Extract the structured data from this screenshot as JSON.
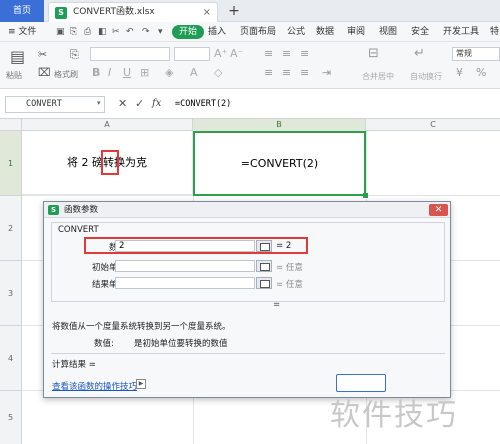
{
  "tabbar": {
    "home": "首页",
    "file_tab": "CONVERT函数.xlsx",
    "xls_badge": "S",
    "close": "×",
    "new_tab": "+"
  },
  "menubar": {
    "file": "≡ 文件",
    "items": [
      "开始",
      "插入",
      "页面布局",
      "公式",
      "数据",
      "审阅",
      "视图",
      "安全",
      "开发工具"
    ],
    "more": "特"
  },
  "ribbon": {
    "paste": "粘贴",
    "format_painter": "格式刷",
    "merge": "合并居中",
    "wrap": "自动换行",
    "style_value": "常规",
    "currency": "¥"
  },
  "formula_bar": {
    "name_box": "CONVERT",
    "fx": "fx",
    "formula": "=CONVERT(2)"
  },
  "columns": [
    "A",
    "B",
    "C"
  ],
  "rows": [
    "1",
    "2",
    "3",
    "4",
    "5"
  ],
  "cells": {
    "a1_pre": "将 ",
    "a1_num": "2",
    "a1_post": " 磅转换为克",
    "b1": "=CONVERT(2)"
  },
  "dialog": {
    "icon": "S",
    "title": "函数参数",
    "close": "✕",
    "function_name": "CONVERT",
    "args": [
      {
        "label": "数值",
        "value": "2",
        "result": "= 2"
      },
      {
        "label": "初始单位",
        "value": "",
        "result": "= 任意"
      },
      {
        "label": "结果单位",
        "value": "",
        "result": "= 任意"
      }
    ],
    "result_eq": "=",
    "description": "将数值从一个度量系统转换到另一个度量系统。",
    "param_name": "数值:",
    "param_desc": "是初始单位要转换的数值",
    "calc_result": "计算结果 =",
    "help_link": "查看该函数的操作技巧"
  },
  "watermark": "软件技巧",
  "colors": {
    "accent_blue": "#3c6fd6",
    "accent_green": "#1f9d55",
    "highlight_red": "#e03a3a",
    "selection_green": "#2e9e4f"
  }
}
